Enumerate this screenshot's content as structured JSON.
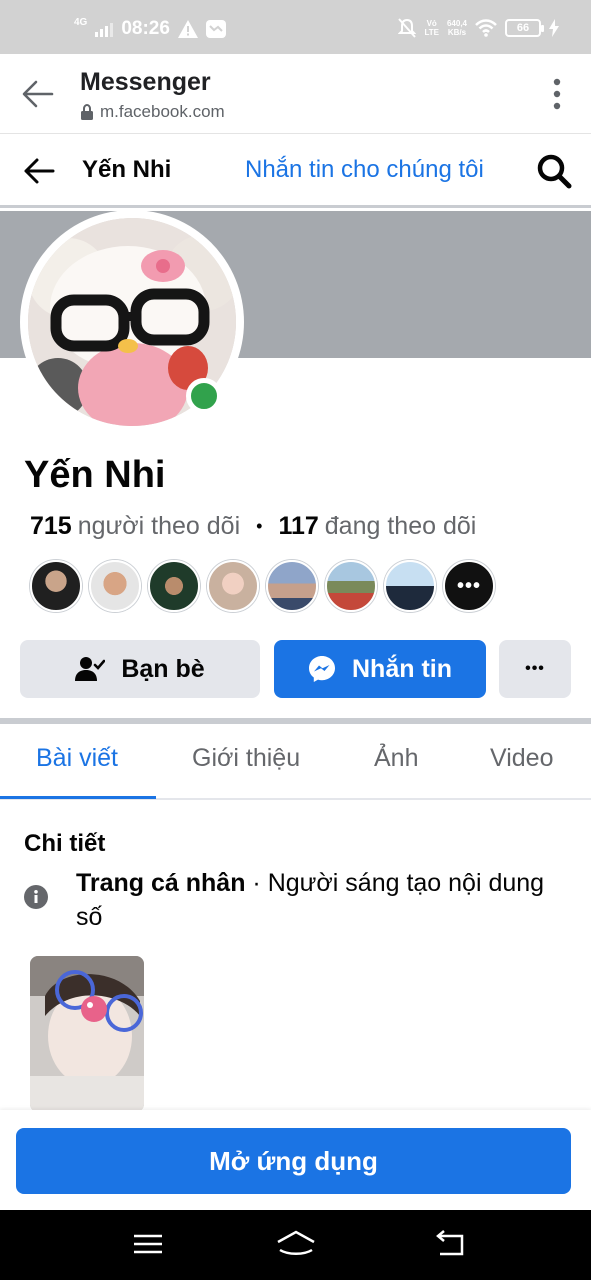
{
  "status_bar": {
    "network": "4G",
    "time": "08:26",
    "speed_value": "640,4",
    "speed_unit": "KB/s",
    "volte": "Vỏ",
    "lte": "LTE",
    "battery": "66",
    "icons": [
      "alert-icon",
      "message-icon",
      "mute-icon",
      "wifi-icon",
      "charging-icon"
    ]
  },
  "browser": {
    "title": "Messenger",
    "url": "m.facebook.com"
  },
  "header": {
    "name": "Yến Nhi",
    "message_link": "Nhắn tin cho chúng tôi"
  },
  "profile": {
    "name": "Yến Nhi",
    "followers_count": "715",
    "followers_label": "người theo dõi",
    "following_count": "117",
    "following_label": "đang theo dõi",
    "online": true
  },
  "actions": {
    "friends_label": "Bạn bè",
    "message_label": "Nhắn tin",
    "more_label": "•••"
  },
  "tabs": [
    {
      "label": "Bài viết",
      "active": true
    },
    {
      "label": "Giới thiệu",
      "active": false
    },
    {
      "label": "Ảnh",
      "active": false
    },
    {
      "label": "Video",
      "active": false
    }
  ],
  "details": {
    "title": "Chi tiết",
    "category_bold": "Trang cá nhân",
    "category_rest": " · Người sáng tạo nội dung số"
  },
  "open_app_label": "Mở ứng dụng",
  "colors": {
    "accent": "#1b74e4",
    "online": "#31a24c",
    "cover": "#a5a9ae"
  }
}
